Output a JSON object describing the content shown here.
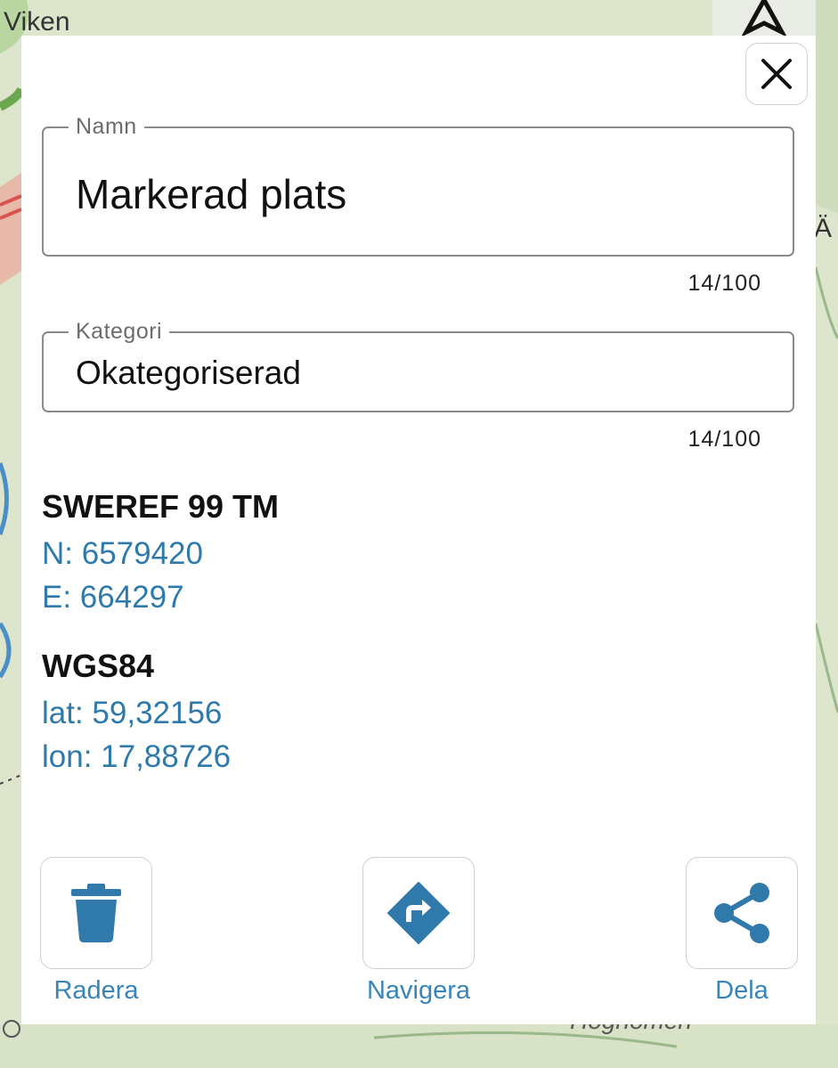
{
  "map": {
    "labels": [
      "Viken",
      "Ä",
      "Hoghomen"
    ]
  },
  "dialog": {
    "close_icon": "close-icon",
    "name_field": {
      "label": "Namn",
      "value": "Markerad plats",
      "counter": "14/100"
    },
    "category_field": {
      "label": "Kategori",
      "value": "Okategoriserad",
      "counter": "14/100"
    },
    "sweref": {
      "title": "SWEREF 99 TM",
      "north": "N: 6579420",
      "east": "E: 664297"
    },
    "wgs84": {
      "title": "WGS84",
      "lat": "lat: 59,32156",
      "lon": "lon: 17,88726"
    },
    "actions": {
      "delete_label": "Radera",
      "navigate_label": "Navigera",
      "share_label": "Dela"
    },
    "colors": {
      "accent": "#2f7aab",
      "label_accent": "#3a85b8"
    }
  }
}
